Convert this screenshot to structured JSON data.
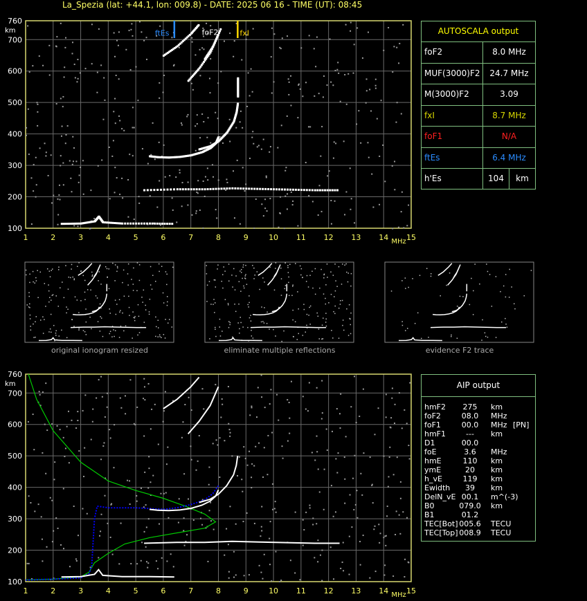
{
  "header": {
    "title": "La_Spezia (lat: +44.1, lon: 009.8) - DATE: 2025 06 16 - TIME (UT): 08:45"
  },
  "autoscala": {
    "title": "AUTOSCALA output",
    "rows": [
      {
        "key": "foF2",
        "value": "8.0 MHz",
        "color": "#ffffff"
      },
      {
        "key": "MUF(3000)F2",
        "value": "24.7 MHz",
        "color": "#ffffff"
      },
      {
        "key": "M(3000)F2",
        "value": "3.09",
        "color": "#ffffff"
      },
      {
        "key": "fxI",
        "value": "8.7 MHz",
        "color": "#d8d800"
      },
      {
        "key": "foF1",
        "value": "N/A",
        "color": "#ff2020"
      },
      {
        "key": "ftEs",
        "value": "6.4 MHz",
        "color": "#2a8cff"
      },
      {
        "key": "h'Es",
        "value": "104",
        "unit": "km",
        "color": "#ffffff"
      }
    ]
  },
  "aip": {
    "title": "AIP output",
    "rows": [
      [
        "hmF2",
        "275",
        "km",
        ""
      ],
      [
        "foF2",
        "08.0",
        "MHz",
        ""
      ],
      [
        "foF1",
        "00.0",
        "MHz",
        "[PN]"
      ],
      [
        "hmF1",
        "---",
        "km",
        ""
      ],
      [
        "D1",
        "00.0",
        "",
        ""
      ],
      [
        "foE",
        "3.6",
        "MHz",
        ""
      ],
      [
        "hmE",
        "110",
        "km",
        ""
      ],
      [
        "ymE",
        "20",
        "km",
        ""
      ],
      [
        "h_vE",
        "119",
        "km",
        ""
      ],
      [
        "Ewidth",
        "39",
        "km",
        ""
      ],
      [
        "DelN_vE",
        "00.1",
        "m^(-3)",
        ""
      ],
      [
        "B0",
        "079.0",
        "km",
        ""
      ],
      [
        "B1",
        "01.2",
        "",
        ""
      ],
      [
        "TEC[Bot]",
        "005.6",
        "TECU",
        ""
      ],
      [
        "TEC[Top]",
        "008.9",
        "TECU",
        ""
      ]
    ]
  },
  "captions": [
    "original ionogram resized",
    "eliminate multiple reflections",
    "evidence F2 trace"
  ],
  "chart_data": [
    {
      "type": "scatter",
      "title": "",
      "xlabel": "MHz",
      "ylabel": "km",
      "xlim": [
        1,
        15
      ],
      "ylim": [
        100,
        760
      ],
      "xticks": [
        "1",
        "2",
        "3",
        "4",
        "5",
        "6",
        "7",
        "8",
        "9",
        "10",
        "11",
        "12",
        "13",
        "14",
        "15"
      ],
      "yticks": [
        "100",
        "200",
        "300",
        "400",
        "500",
        "600",
        "700",
        "760"
      ],
      "grid": true,
      "markers": [
        {
          "name": "ftEs",
          "x": 6.4,
          "color": "#2a8cff"
        },
        {
          "name": "fxI",
          "x": 8.7,
          "color": "#ffd800"
        }
      ],
      "annotations": [
        {
          "text": "foF2",
          "x": 7.4,
          "y": 715
        }
      ],
      "series": [
        {
          "values": [
            [
              5.5,
              330
            ],
            [
              5.8,
              327
            ],
            [
              6.2,
              326
            ],
            [
              6.6,
              328
            ],
            [
              7.0,
              333
            ],
            [
              7.4,
              343
            ],
            [
              7.7,
              356
            ],
            [
              7.9,
              372
            ],
            [
              8.0,
              392
            ]
          ]
        },
        {
          "values": [
            [
              7.3,
              352
            ],
            [
              7.7,
              362
            ],
            [
              8.0,
              378
            ],
            [
              8.3,
              405
            ],
            [
              8.55,
              440
            ],
            [
              8.65,
              470
            ],
            [
              8.7,
              500
            ]
          ]
        },
        {
          "values": [
            [
              6.0,
              650
            ],
            [
              6.5,
              680
            ],
            [
              7.0,
              720
            ],
            [
              7.3,
              750
            ]
          ]
        },
        {
          "values": [
            [
              6.9,
              570
            ],
            [
              7.3,
              610
            ],
            [
              7.7,
              660
            ],
            [
              8.0,
              720
            ]
          ]
        },
        {
          "values": [
            [
              7.5,
              640
            ],
            [
              7.8,
              680
            ],
            [
              8.1,
              740
            ]
          ]
        },
        {
          "values": [
            [
              8.7,
              520
            ],
            [
              8.7,
              540
            ],
            [
              8.7,
              560
            ],
            [
              8.7,
              580
            ]
          ]
        },
        {
          "values": [
            [
              2.3,
              115
            ],
            [
              3.0,
              116
            ],
            [
              3.5,
              123
            ],
            [
              3.65,
              138
            ],
            [
              3.8,
              120
            ],
            [
              4.5,
              116
            ],
            [
              5.5,
              116
            ],
            [
              6.4,
              115
            ]
          ]
        },
        {
          "values": [
            [
              5.3,
              222
            ],
            [
              6.5,
              225
            ],
            [
              7.5,
              225
            ],
            [
              8.5,
              228
            ],
            [
              9.5,
              226
            ],
            [
              10.5,
              224
            ],
            [
              11.5,
              222
            ],
            [
              12.4,
              222
            ]
          ]
        }
      ]
    },
    {
      "type": "line",
      "title": "",
      "xlabel": "MHz",
      "ylabel": "km",
      "xlim": [
        1,
        15
      ],
      "ylim": [
        100,
        760
      ],
      "xticks": [
        "1",
        "2",
        "3",
        "4",
        "5",
        "6",
        "7",
        "8",
        "9",
        "10",
        "11",
        "12",
        "13",
        "14",
        "15"
      ],
      "yticks": [
        "100",
        "200",
        "300",
        "400",
        "500",
        "600",
        "700",
        "760"
      ],
      "grid": true,
      "series": [
        {
          "color": "#00cc00",
          "values": [
            [
              1.1,
              760
            ],
            [
              1.4,
              680
            ],
            [
              2.0,
              580
            ],
            [
              3.0,
              480
            ],
            [
              4.0,
              420
            ],
            [
              5.0,
              390
            ],
            [
              6.0,
              365
            ],
            [
              6.8,
              340
            ],
            [
              7.5,
              315
            ],
            [
              7.9,
              290
            ],
            [
              7.5,
              270
            ],
            [
              6.5,
              255
            ],
            [
              5.5,
              240
            ],
            [
              4.6,
              220
            ],
            [
              4.0,
              190
            ],
            [
              3.5,
              160
            ],
            [
              3.3,
              130
            ],
            [
              3.0,
              115
            ],
            [
              2.0,
              108
            ],
            [
              1.0,
              106
            ]
          ]
        },
        {
          "color": "#0000ff",
          "values": [
            [
              1.0,
              105
            ],
            [
              2.0,
              108
            ],
            [
              3.0,
              112
            ],
            [
              3.3,
              125
            ],
            [
              3.4,
              150
            ],
            [
              3.5,
              300
            ],
            [
              3.6,
              340
            ],
            [
              4.0,
              335
            ],
            [
              5.0,
              335
            ],
            [
              6.0,
              330
            ],
            [
              6.5,
              335
            ],
            [
              7.0,
              345
            ],
            [
              7.5,
              360
            ],
            [
              7.8,
              380
            ],
            [
              8.0,
              405
            ]
          ]
        },
        {
          "color": "#ffffff",
          "values": [
            [
              5.5,
              330
            ],
            [
              5.8,
              327
            ],
            [
              6.2,
              326
            ],
            [
              6.6,
              328
            ],
            [
              7.0,
              333
            ],
            [
              7.4,
              343
            ],
            [
              7.7,
              356
            ],
            [
              7.9,
              372
            ],
            [
              8.0,
              392
            ]
          ]
        },
        {
          "color": "#ffffff",
          "values": [
            [
              7.3,
              352
            ],
            [
              7.7,
              362
            ],
            [
              8.0,
              378
            ],
            [
              8.3,
              405
            ],
            [
              8.55,
              440
            ],
            [
              8.65,
              470
            ],
            [
              8.7,
              500
            ]
          ]
        },
        {
          "color": "#ffffff",
          "values": [
            [
              6.0,
              650
            ],
            [
              6.5,
              680
            ],
            [
              7.0,
              720
            ],
            [
              7.3,
              750
            ]
          ]
        },
        {
          "color": "#ffffff",
          "values": [
            [
              6.9,
              570
            ],
            [
              7.3,
              610
            ],
            [
              7.7,
              660
            ],
            [
              8.0,
              720
            ]
          ]
        },
        {
          "color": "#ffffff",
          "values": [
            [
              2.3,
              115
            ],
            [
              3.0,
              116
            ],
            [
              3.5,
              123
            ],
            [
              3.65,
              138
            ],
            [
              3.8,
              120
            ],
            [
              4.5,
              116
            ],
            [
              5.5,
              116
            ],
            [
              6.4,
              115
            ]
          ]
        },
        {
          "color": "#ffffff",
          "values": [
            [
              5.3,
              222
            ],
            [
              6.5,
              225
            ],
            [
              7.5,
              225
            ],
            [
              8.5,
              228
            ],
            [
              9.5,
              226
            ],
            [
              10.5,
              224
            ],
            [
              11.5,
              222
            ],
            [
              12.4,
              222
            ]
          ]
        }
      ]
    }
  ]
}
